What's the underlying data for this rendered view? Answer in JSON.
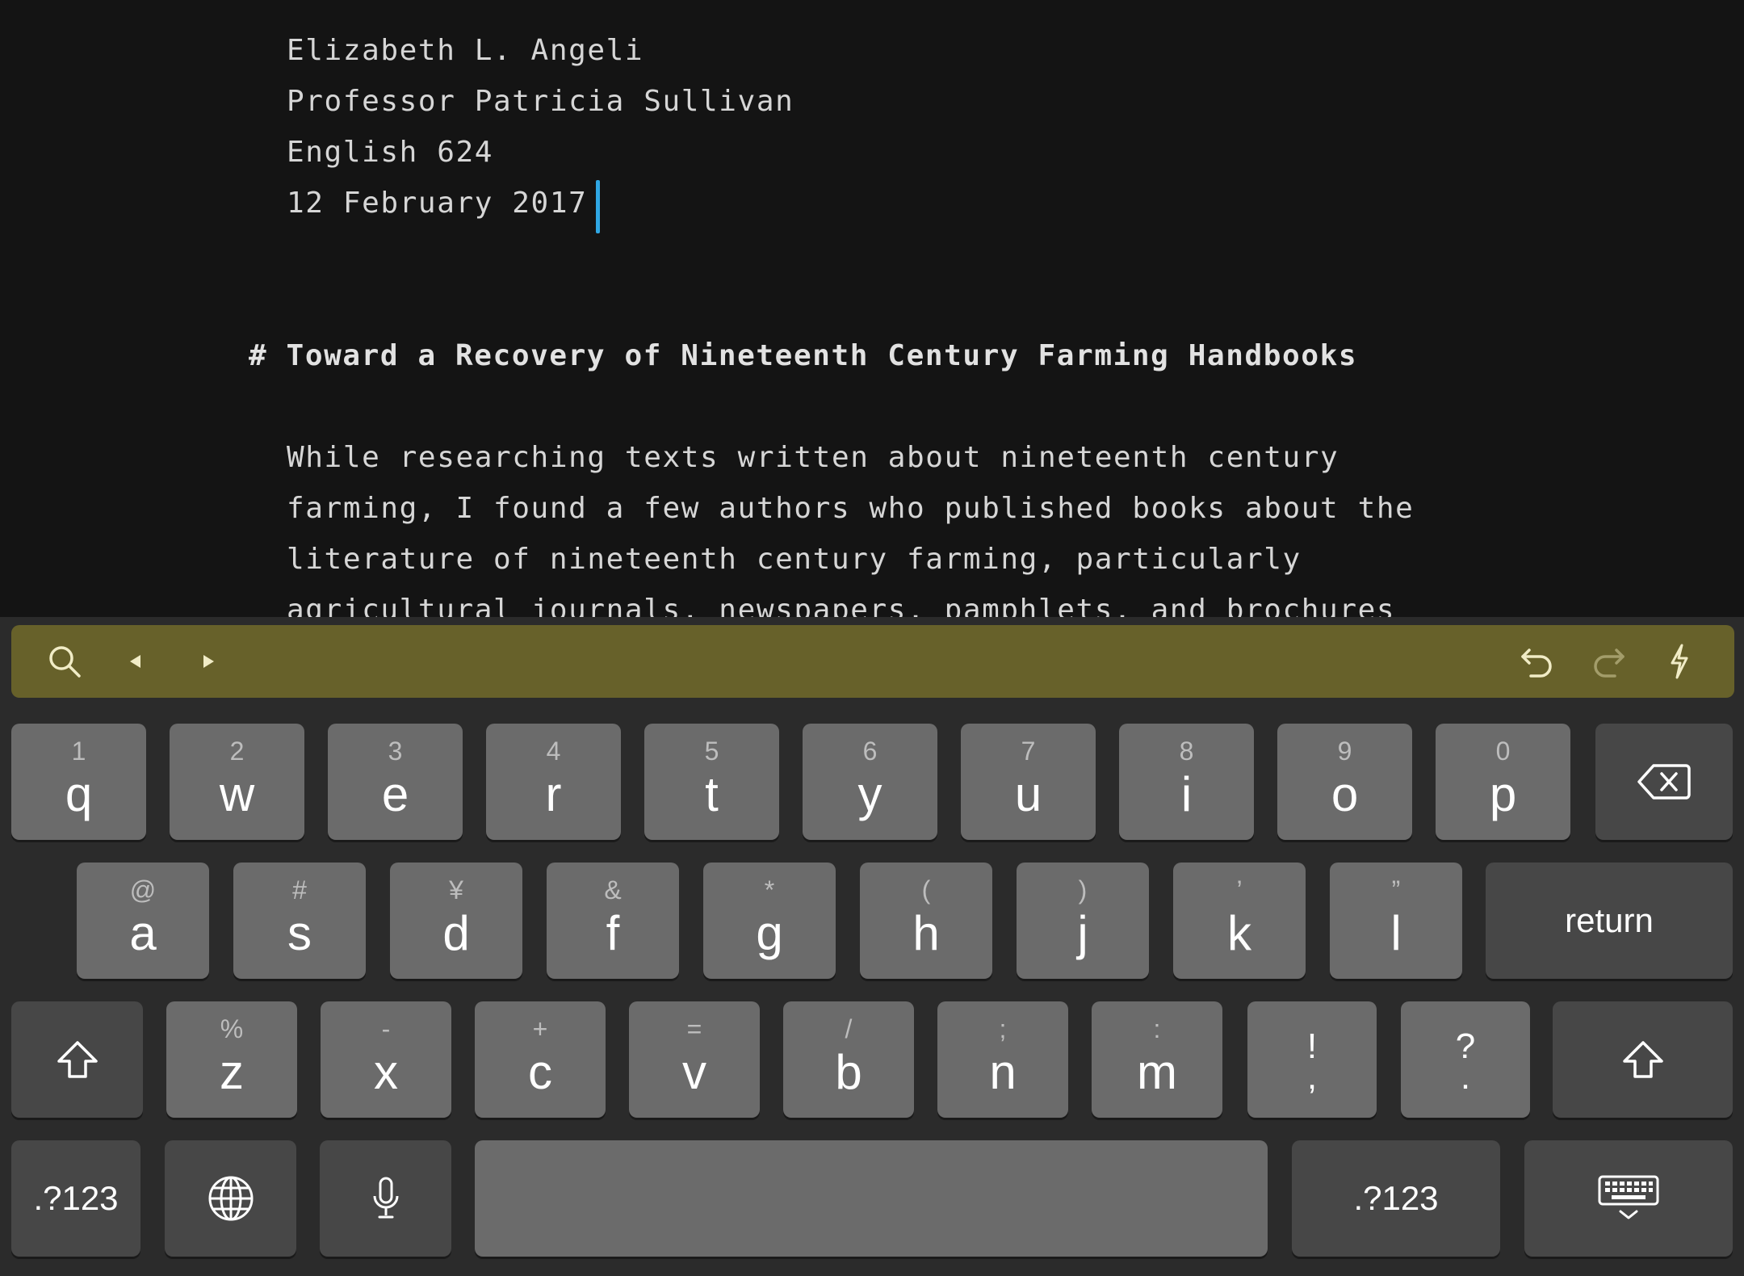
{
  "editor": {
    "lines": [
      "Elizabeth L. Angeli",
      "Professor Patricia Sullivan",
      "English 624",
      "12 February 2017"
    ],
    "heading": "# Toward a Recovery of Nineteenth Century Farming Handbooks",
    "paragraph": [
      "While researching texts written about nineteenth century",
      "farming, I found a few authors who published books about the",
      "literature of nineteenth century farming, particularly",
      "agricultural journals, newspapers, pamphlets, and brochures"
    ]
  },
  "toolbar": {
    "color": "#67612a",
    "left_icons": [
      "search-icon",
      "arrow-left-icon",
      "arrow-right-icon"
    ],
    "right_icons": [
      "undo-icon",
      "redo-icon",
      "lightning-icon"
    ]
  },
  "keyboard": {
    "row1": [
      {
        "sub": "1",
        "main": "q"
      },
      {
        "sub": "2",
        "main": "w"
      },
      {
        "sub": "3",
        "main": "e"
      },
      {
        "sub": "4",
        "main": "r"
      },
      {
        "sub": "5",
        "main": "t"
      },
      {
        "sub": "6",
        "main": "y"
      },
      {
        "sub": "7",
        "main": "u"
      },
      {
        "sub": "8",
        "main": "i"
      },
      {
        "sub": "9",
        "main": "o"
      },
      {
        "sub": "0",
        "main": "p"
      }
    ],
    "row2": [
      {
        "sub": "@",
        "main": "a"
      },
      {
        "sub": "#",
        "main": "s"
      },
      {
        "sub": "¥",
        "main": "d"
      },
      {
        "sub": "&",
        "main": "f"
      },
      {
        "sub": "*",
        "main": "g"
      },
      {
        "sub": "(",
        "main": "h"
      },
      {
        "sub": ")",
        "main": "j"
      },
      {
        "sub": "’",
        "main": "k"
      },
      {
        "sub": "”",
        "main": "l"
      }
    ],
    "row3": [
      {
        "sub": "%",
        "main": "z"
      },
      {
        "sub": "-",
        "main": "x"
      },
      {
        "sub": "+",
        "main": "c"
      },
      {
        "sub": "=",
        "main": "v"
      },
      {
        "sub": "/",
        "main": "b"
      },
      {
        "sub": ";",
        "main": "n"
      },
      {
        "sub": ":",
        "main": "m"
      }
    ],
    "punct": [
      {
        "top": "!",
        "bottom": ","
      },
      {
        "top": "?",
        "bottom": "."
      }
    ],
    "return_label": "return",
    "numbers_label": ".?123",
    "key_color": "#6b6b6b",
    "dark_key_color": "#474747",
    "background_color": "#2b2b2b"
  }
}
